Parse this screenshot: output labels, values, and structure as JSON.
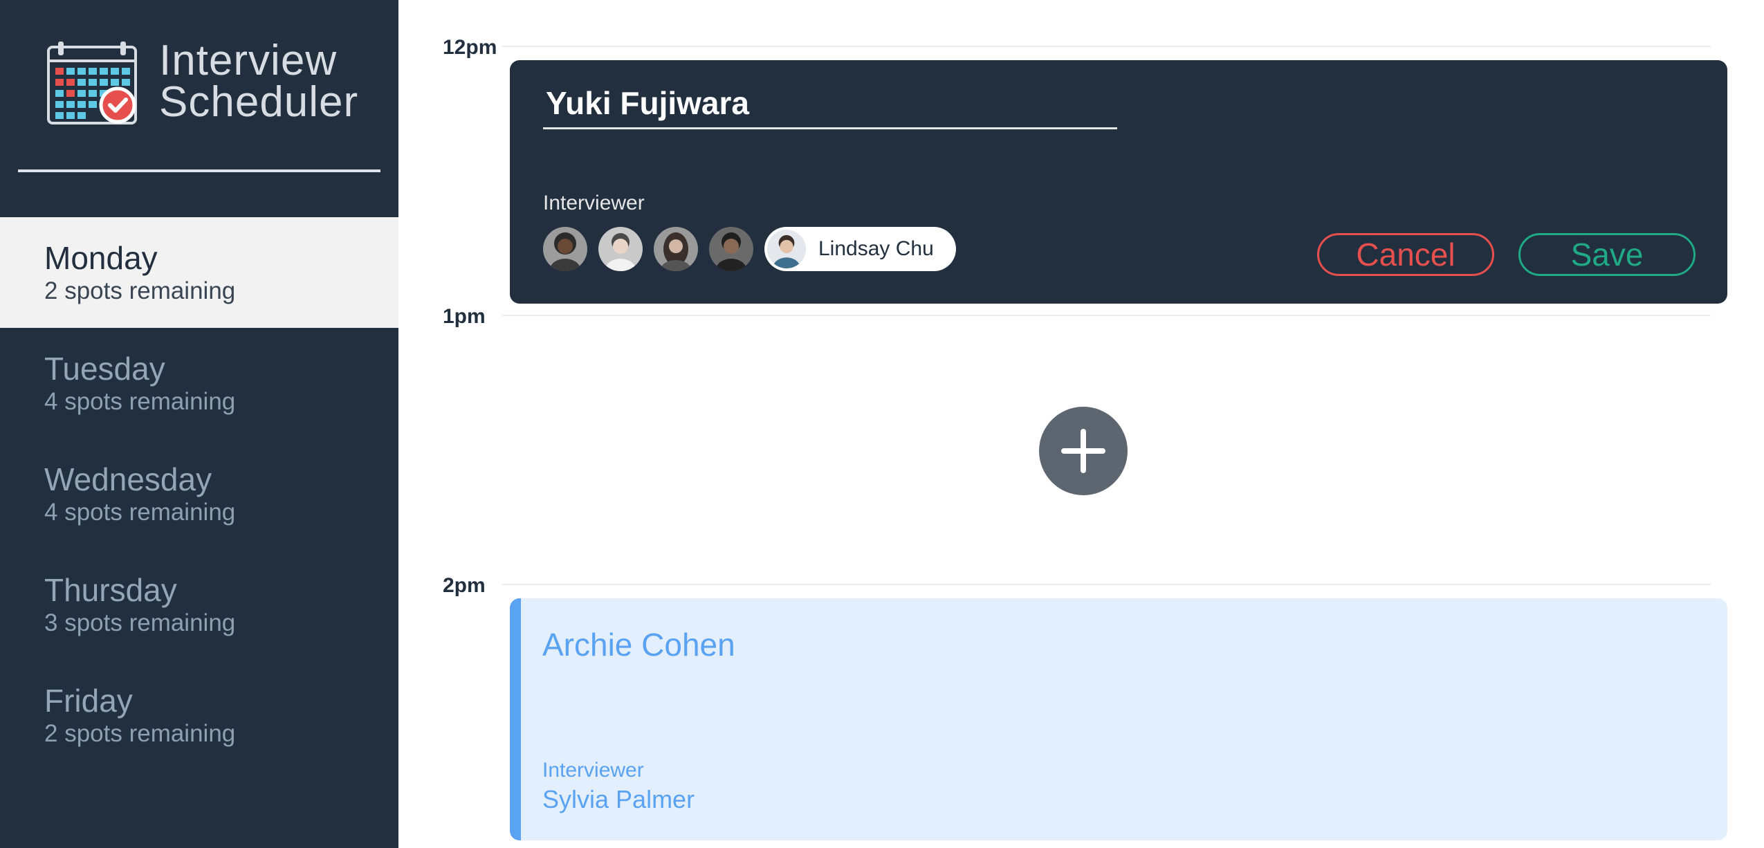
{
  "app": {
    "title_line1": "Interview",
    "title_line2": "Scheduler",
    "logo_icon": "calendar-check-icon"
  },
  "sidebar": {
    "days": [
      {
        "name": "Monday",
        "spots": "2 spots remaining",
        "selected": true
      },
      {
        "name": "Tuesday",
        "spots": "4 spots remaining",
        "selected": false
      },
      {
        "name": "Wednesday",
        "spots": "4 spots remaining",
        "selected": false
      },
      {
        "name": "Thursday",
        "spots": "3 spots remaining",
        "selected": false
      },
      {
        "name": "Friday",
        "spots": "2 spots remaining",
        "selected": false
      }
    ]
  },
  "schedule": {
    "times": [
      "12pm",
      "1pm",
      "2pm"
    ],
    "edit_form": {
      "student_name": "Yuki Fujiwara",
      "interviewer_label": "Interviewer",
      "interviewers": [
        {
          "icon": "interviewer-avatar-icon"
        },
        {
          "icon": "interviewer-avatar-icon"
        },
        {
          "icon": "interviewer-avatar-icon"
        },
        {
          "icon": "interviewer-avatar-icon"
        }
      ],
      "selected_interviewer": "Lindsay Chu",
      "cancel_label": "Cancel",
      "save_label": "Save"
    },
    "add_button_icon": "plus-icon",
    "appointment": {
      "student": "Archie Cohen",
      "interviewer_label": "Interviewer",
      "interviewer": "Sylvia Palmer"
    }
  },
  "colors": {
    "sidebar_bg": "#222f3e",
    "selected_day_bg": "#f2f2f2",
    "cancel": "#e5504f",
    "save": "#1fa985",
    "appointment_accent": "#5aa2f2",
    "appointment_bg": "#e3effd",
    "add_button": "#5d6670"
  }
}
